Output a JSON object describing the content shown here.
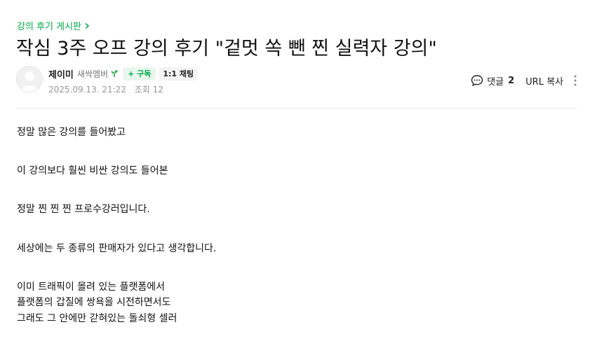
{
  "board": {
    "label": "강의 후기 게시판"
  },
  "post": {
    "title": "작심 3주 오프 강의 후기 \"겉멋 쏙 뺀 찐 실력자 강의\"",
    "author": {
      "name": "제이미",
      "level": "새싹멤버",
      "subscribe_label": "+ 구독",
      "chat_label": "1:1 채팅"
    },
    "date": "2025.09.13. 21:22",
    "views_label": "조회 12"
  },
  "tools": {
    "comment_label": "댓글",
    "comment_count": "2",
    "url_copy_label": "URL 복사"
  },
  "content": {
    "lines": [
      "정말 많은 강의를 들어봤고",
      "이 강의보다 훨씬 비싼 강의도 들어본",
      "정말 찐 찐 찐 프로수강러입니다.",
      "세상에는 두 종류의 판매자가 있다고 생각합니다.",
      "이미 트래픽이 몰려 있는 플랫폼에서",
      "플랫폼의 갑질에 쌍욕을 시전하면서도",
      "그래도 그 안에만 갇혀있는 돌쇠형 셀러"
    ]
  },
  "colors": {
    "accent": "#03a94d",
    "subscribe_bg": "#e8f7ee",
    "meta": "#979797"
  },
  "icons": {
    "board_chevron": "chevron-right-icon",
    "level_badge": "sprout-icon",
    "comment": "speech-bubble-icon",
    "more": "vertical-dots-icon",
    "avatar": "default-profile-icon"
  }
}
